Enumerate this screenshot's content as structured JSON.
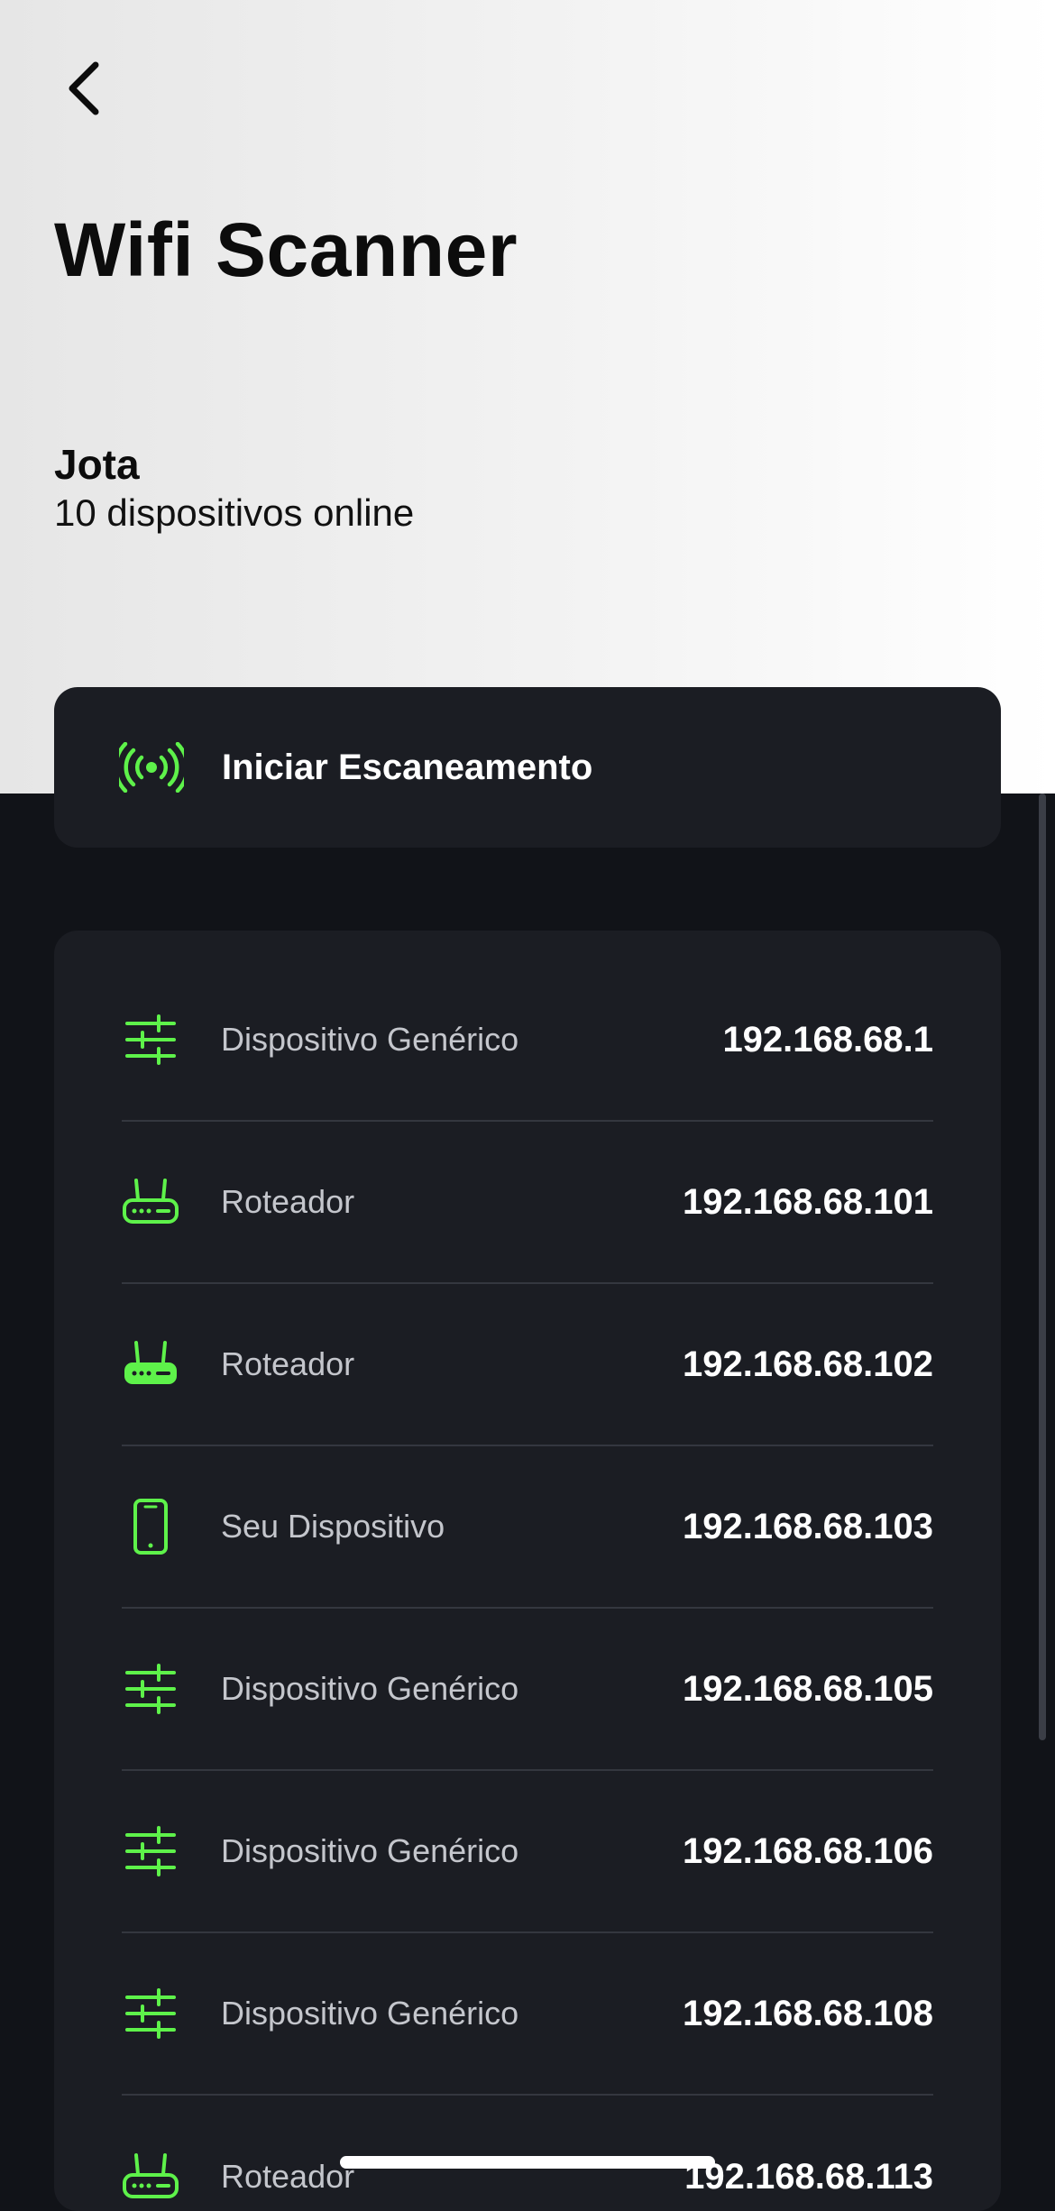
{
  "header": {
    "title": "Wifi Scanner",
    "network_name": "Jota",
    "device_count": "10 dispositivos online"
  },
  "scan_button": {
    "label": "Iniciar Escaneamento",
    "icon": "wifi-broadcast-icon"
  },
  "colors": {
    "accent": "#5ef24a",
    "dark_bg": "#111318",
    "card_bg": "#1b1d23"
  },
  "devices": [
    {
      "type": "Dispositivo Genérico",
      "ip": "192.168.68.1",
      "icon": "sliders-icon"
    },
    {
      "type": "Roteador",
      "ip": "192.168.68.101",
      "icon": "router-icon"
    },
    {
      "type": "Roteador",
      "ip": "192.168.68.102",
      "icon": "router-icon"
    },
    {
      "type": "Seu Dispositivo",
      "ip": "192.168.68.103",
      "icon": "smartphone-icon"
    },
    {
      "type": "Dispositivo Genérico",
      "ip": "192.168.68.105",
      "icon": "sliders-icon"
    },
    {
      "type": "Dispositivo Genérico",
      "ip": "192.168.68.106",
      "icon": "sliders-icon"
    },
    {
      "type": "Dispositivo Genérico",
      "ip": "192.168.68.108",
      "icon": "sliders-icon"
    },
    {
      "type": "Roteador",
      "ip": "192.168.68.113",
      "icon": "router-icon"
    }
  ]
}
